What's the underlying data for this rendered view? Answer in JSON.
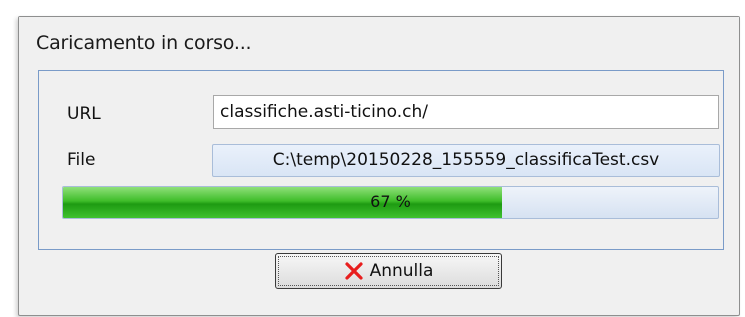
{
  "window": {
    "title": "Caricamento in corso..."
  },
  "form": {
    "url_label": "URL",
    "url_value": "classifiche.asti-ticino.ch/",
    "file_label": "File",
    "file_value": "C:\\temp\\20150228_155559_classificaTest.csv"
  },
  "progress": {
    "percent": 67,
    "text": "67 %"
  },
  "actions": {
    "cancel_label": "Annulla",
    "cancel_icon": "close-icon"
  },
  "colors": {
    "progress_fill": "#2eaa1f",
    "cancel_icon": "#e81e1e",
    "group_border": "#7a9bc8"
  }
}
